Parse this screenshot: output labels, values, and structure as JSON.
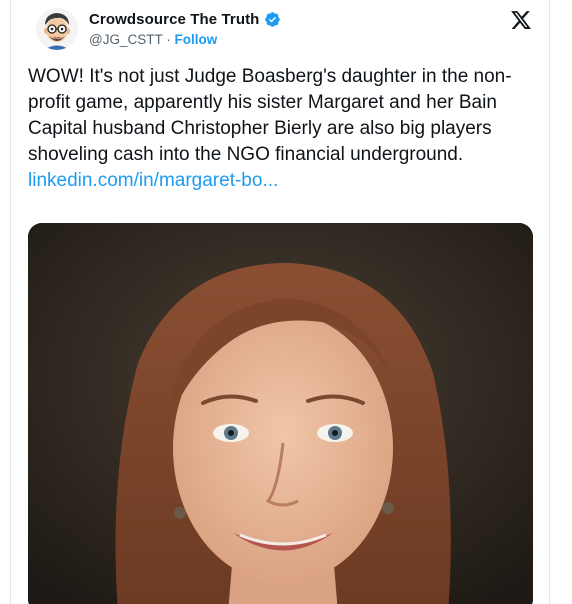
{
  "tweet": {
    "author": {
      "display_name": "Crowdsource The Truth",
      "handle": "@JG_CSTT",
      "separator": " · ",
      "follow_label": "Follow",
      "verified": true,
      "avatar_icon": "cartoon-avatar-icon"
    },
    "text": "WOW! It's not just Judge Boasberg's daughter in the non-profit game, apparently his sister Margaret and her Bain Capital husband Christopher Bierly are also big players shoveling cash into the NGO financial underground.",
    "link_text": "linkedin.com/in/margaret-bo...",
    "platform_icon": "x-logo-icon",
    "media_icon": "portrait-photo-icon"
  },
  "colors": {
    "accent": "#1d9bf0",
    "text_primary": "#0f1419",
    "text_secondary": "#536471",
    "border": "#e1e8ed"
  }
}
